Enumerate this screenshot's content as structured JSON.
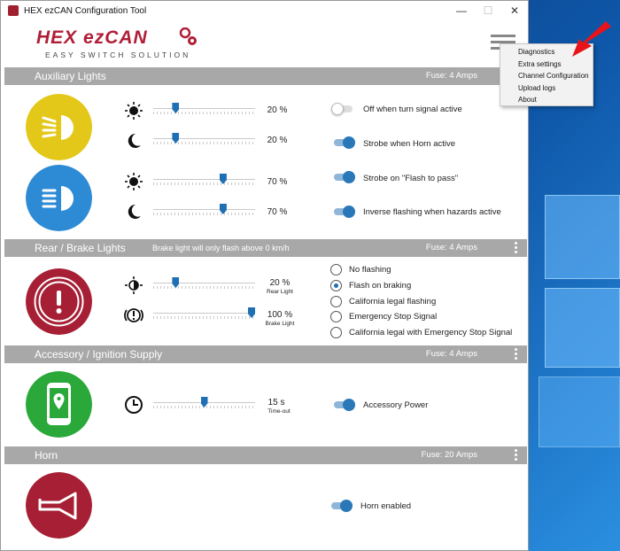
{
  "window": {
    "title": "HEX ezCAN Configuration Tool",
    "minimize": "—",
    "maximize": "☐",
    "close": "✕"
  },
  "logo": {
    "brand_a": "HEX",
    "brand_b": "ezCAN",
    "tagline": "EASY SWITCH SOLUTION"
  },
  "menu": {
    "items": [
      "Diagnostics",
      "Extra settings",
      "Channel Configuration",
      "Upload logs",
      "About"
    ]
  },
  "colors": {
    "brand": "#b01e36",
    "accent": "#1f6fb5",
    "aux1": "#e3c719",
    "aux2": "#2d8bd6",
    "rear": "#a71f34",
    "accessory": "#2aa83a",
    "horn": "#a71f34"
  },
  "aux": {
    "title": "Auxiliary Lights",
    "fuse": "Fuse: 4 Amps",
    "sliders": [
      {
        "icon": "sun-icon",
        "value": 20,
        "label": "20 %"
      },
      {
        "icon": "moon-icon",
        "value": 20,
        "label": "20 %"
      },
      {
        "icon": "sun-icon",
        "value": 70,
        "label": "70 %"
      },
      {
        "icon": "moon-icon",
        "value": 70,
        "label": "70 %"
      }
    ],
    "toggles": [
      {
        "label": "Off when turn signal active",
        "on": false
      },
      {
        "label": "Strobe when Horn active",
        "on": true
      },
      {
        "label": "Strobe on \"Flash to pass\"",
        "on": true
      },
      {
        "label": "Inverse flashing when hazards active",
        "on": true
      }
    ]
  },
  "rear": {
    "title": "Rear / Brake Lights",
    "note": "Brake light will only flash above 0 km/h",
    "fuse": "Fuse: 4 Amps",
    "sliders": [
      {
        "value": 20,
        "label": "20 %",
        "sub": "Rear Light"
      },
      {
        "value": 100,
        "label": "100 %",
        "sub": "Brake Light"
      }
    ],
    "radios": [
      "No flashing",
      "Flash on braking",
      "California legal flashing",
      "Emergency Stop Signal",
      "California legal with Emergency Stop Signal"
    ],
    "selected": "Flash on braking"
  },
  "accessory": {
    "title": "Accessory / Ignition Supply",
    "fuse": "Fuse: 4 Amps",
    "slider": {
      "value": 50,
      "label": "15 s",
      "sub": "Time-out"
    },
    "toggle": {
      "label": "Accessory Power",
      "on": true
    }
  },
  "horn": {
    "title": "Horn",
    "fuse": "Fuse: 20 Amps",
    "toggle": {
      "label": "Horn enabled",
      "on": true
    }
  }
}
